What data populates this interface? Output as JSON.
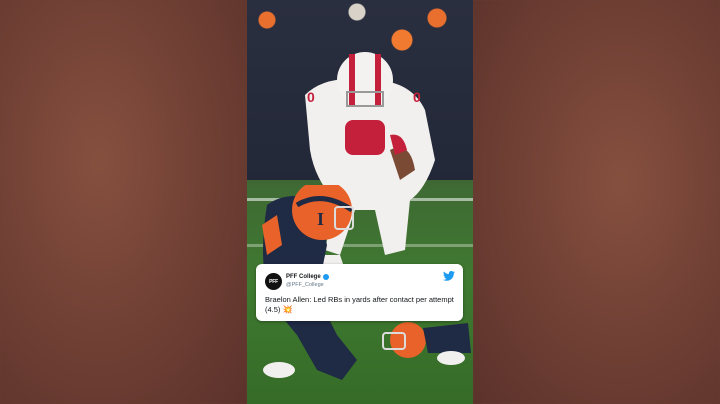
{
  "tweet": {
    "account_name": "PFF College",
    "handle": "@PFF_College",
    "avatar_text": "PFF",
    "text": "Braelon Allen: Led RBs in yards after contact per attempt (4.5)",
    "emoji": "💥",
    "icons": {
      "verified": "verified-badge-icon",
      "platform": "twitter-bird-icon",
      "reaction": "collision-emoji-icon"
    }
  },
  "players": {
    "white_jersey_number": "0",
    "orange_helmet_letter": "I"
  },
  "colors": {
    "backdrop": "#6e3f35",
    "field": "#3f7a30",
    "orange": "#e8622a",
    "navy": "#1f2a44",
    "wisconsin_red": "#c5203b",
    "twitter_blue": "#1d9bf0"
  }
}
